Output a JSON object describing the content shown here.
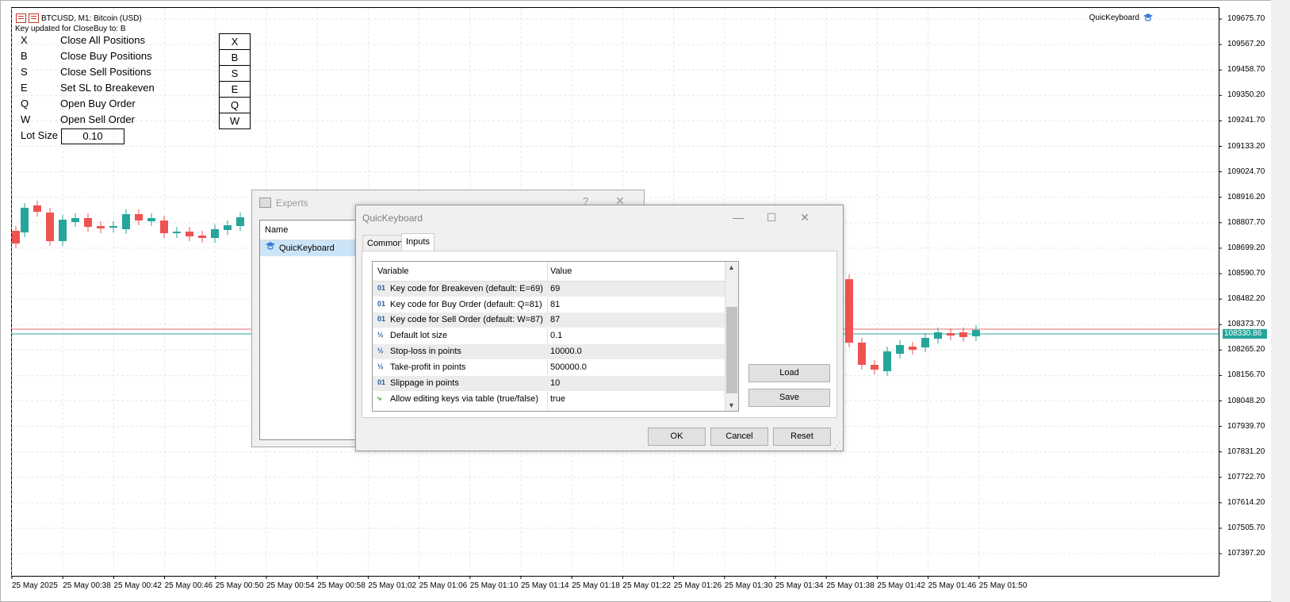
{
  "chart": {
    "symbol_title": "BTCUSD, M1:  Bitcoin (USD)",
    "notice": "Key updated for CloseBuy to: B",
    "indicator_label": "QuicKeyboard",
    "current_price": "108330.86",
    "price_ticks": [
      "109675.70",
      "109567.20",
      "109458.70",
      "109350.20",
      "109241.70",
      "109133.20",
      "109024.70",
      "108916.20",
      "108807.70",
      "108699.20",
      "108590.70",
      "108482.20",
      "108373.70",
      "108265.20",
      "108156.70",
      "108048.20",
      "107939.70",
      "107831.20",
      "107722.70",
      "107614.20",
      "107505.70",
      "107397.20"
    ],
    "time_ticks": [
      "25 May 2025",
      "25 May 00:38",
      "25 May 00:42",
      "25 May 00:46",
      "25 May 00:50",
      "25 May 00:54",
      "25 May 00:58",
      "25 May 01:02",
      "25 May 01:06",
      "25 May 01:10",
      "25 May 01:14",
      "25 May 01:18",
      "25 May 01:22",
      "25 May 01:26",
      "25 May 01:30",
      "25 May 01:34",
      "25 May 01:38",
      "25 May 01:42",
      "25 May 01:46",
      "25 May 01:50"
    ],
    "colors": {
      "bull": "#26a69a",
      "bear": "#ef5350",
      "grid": "#e6e6e6"
    }
  },
  "hotkeys": [
    {
      "key": "X",
      "desc": "Close All Positions",
      "btn": "X"
    },
    {
      "key": "B",
      "desc": "Close Buy Positions",
      "btn": "B"
    },
    {
      "key": "S",
      "desc": "Close Sell Positions",
      "btn": "S"
    },
    {
      "key": "E",
      "desc": "Set SL to Breakeven",
      "btn": "E"
    },
    {
      "key": "Q",
      "desc": "Open Buy Order",
      "btn": "Q"
    },
    {
      "key": "W",
      "desc": "Open Sell Order",
      "btn": "W"
    }
  ],
  "lot": {
    "label": "Lot Size",
    "value": "0.10"
  },
  "experts": {
    "title": "Experts",
    "help": "?",
    "close": "✕",
    "col_name": "Name",
    "item": "QuicKeyboard"
  },
  "dialog": {
    "title": "QuicKeyboard",
    "tabs": [
      "Common",
      "Inputs"
    ],
    "col_variable": "Variable",
    "col_value": "Value",
    "rows": [
      {
        "icon": "01",
        "variable": "Key code for Breakeven (default: E=69)",
        "value": "69"
      },
      {
        "icon": "01",
        "variable": "Key code for Buy Order (default: Q=81)",
        "value": "81"
      },
      {
        "icon": "01",
        "variable": "Key code for Sell Order (default: W=87)",
        "value": "87"
      },
      {
        "icon": "½",
        "variable": "Default lot size",
        "value": "0.1"
      },
      {
        "icon": "½",
        "variable": "Stop-loss in points",
        "value": "10000.0"
      },
      {
        "icon": "½",
        "variable": "Take-profit in points",
        "value": "500000.0"
      },
      {
        "icon": "01",
        "variable": "Slippage in points",
        "value": "10"
      },
      {
        "icon": "⤷",
        "variable": "Allow editing keys via table (true/false)",
        "value": "true"
      }
    ],
    "buttons": {
      "load": "Load",
      "save": "Save",
      "ok": "OK",
      "cancel": "Cancel",
      "reset": "Reset"
    }
  }
}
